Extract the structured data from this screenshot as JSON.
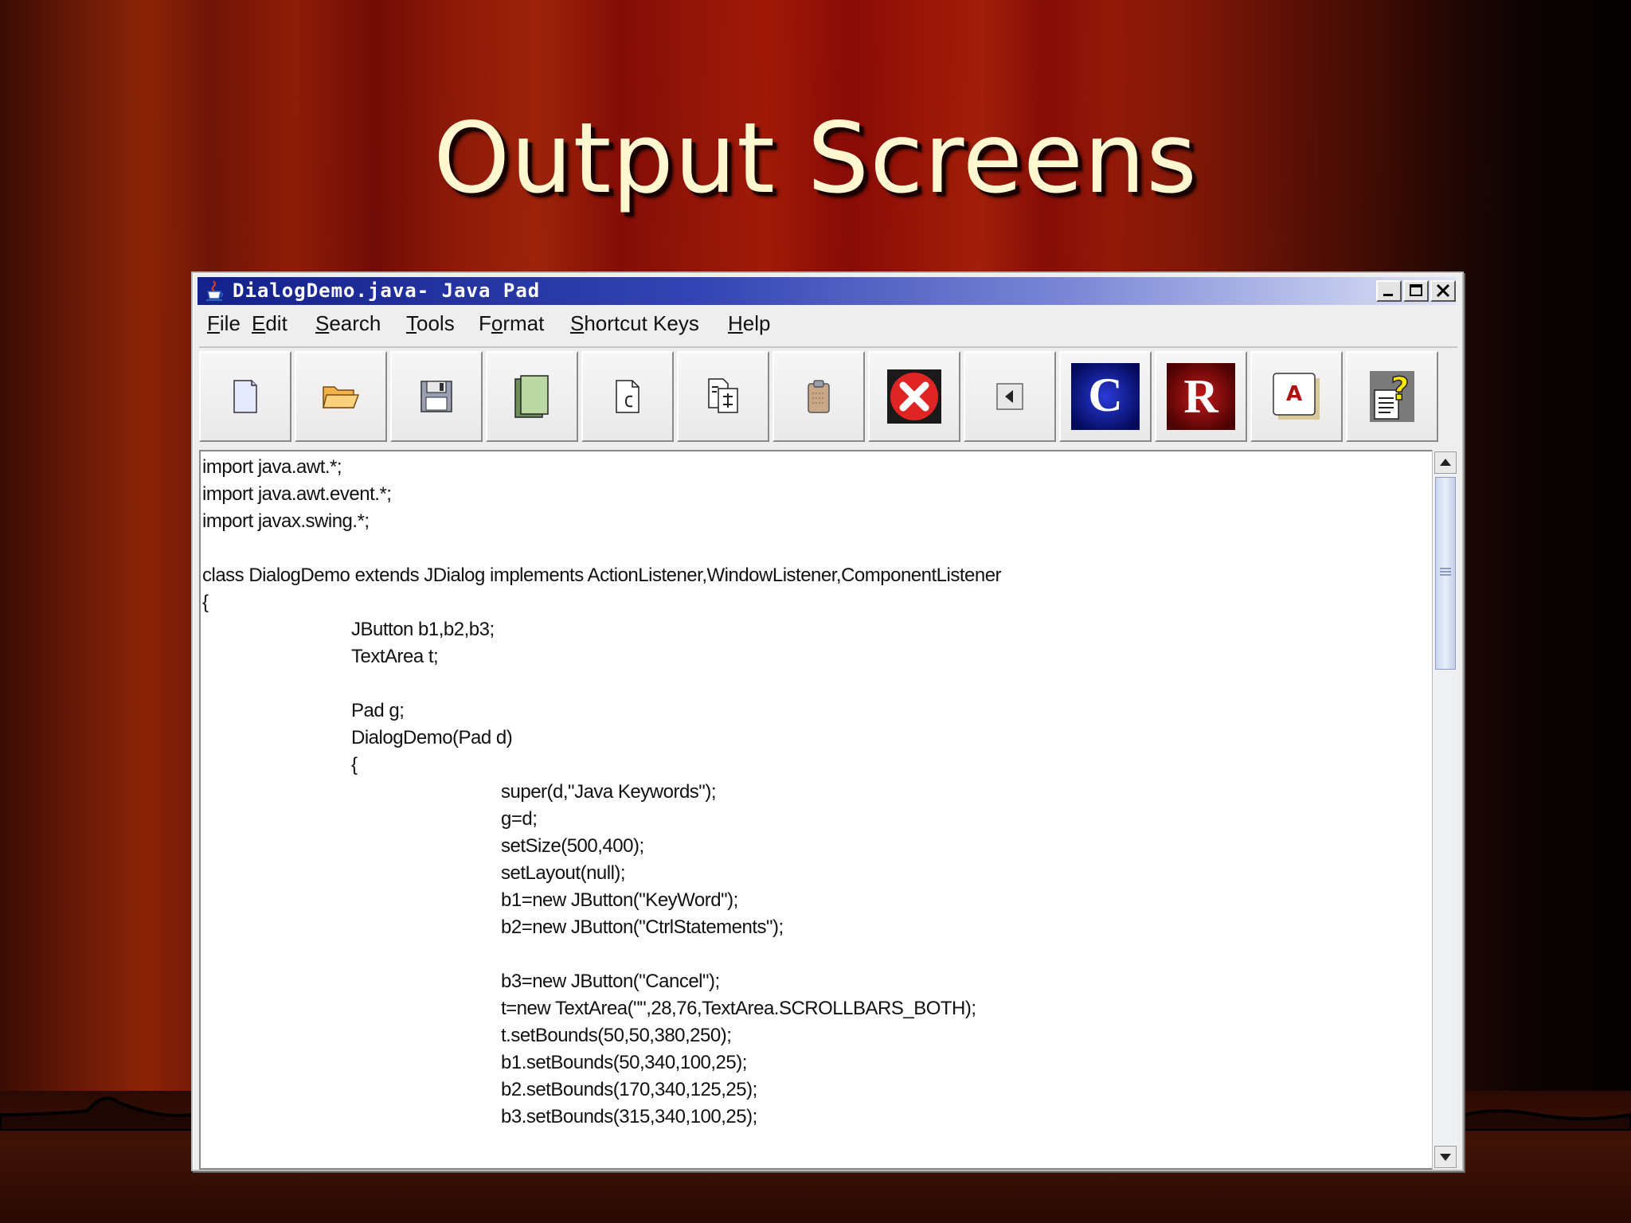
{
  "slide": {
    "title": "Output Screens"
  },
  "window": {
    "title": "DialogDemo.java- Java Pad",
    "controls": {
      "minimize": "minimize",
      "maximize": "maximize",
      "close": "close"
    }
  },
  "menubar": {
    "items": [
      {
        "mnemonic": "F",
        "rest": "ile"
      },
      {
        "mnemonic": "E",
        "rest": "dit"
      },
      {
        "mnemonic": "S",
        "rest": "earch"
      },
      {
        "mnemonic": "T",
        "rest": "ools"
      },
      {
        "pre": "F",
        "mnemonic": "o",
        "rest": "rmat"
      },
      {
        "mnemonic": "S",
        "rest": "hortcut Keys"
      },
      {
        "mnemonic": "H",
        "rest": "elp"
      }
    ]
  },
  "toolbar": {
    "buttons": [
      {
        "icon": "new-file-icon"
      },
      {
        "icon": "open-folder-icon"
      },
      {
        "icon": "save-disk-icon"
      },
      {
        "icon": "copy-pages-icon"
      },
      {
        "icon": "compile-page-icon"
      },
      {
        "icon": "run-page-icon"
      },
      {
        "icon": "clipboard-icon"
      },
      {
        "icon": "close-red-x-icon"
      },
      {
        "icon": "back-arrow-icon"
      },
      {
        "icon": "c-icon",
        "letter": "C"
      },
      {
        "icon": "r-icon",
        "letter": "R"
      },
      {
        "icon": "font-a-icon",
        "letter": "A"
      },
      {
        "icon": "help-icon",
        "letter": "?"
      }
    ]
  },
  "editor": {
    "lines": [
      "import java.awt.*;",
      "import java.awt.event.*;",
      "import javax.swing.*;",
      "",
      "class DialogDemo extends JDialog implements ActionListener,WindowListener,ComponentListener",
      "{",
      "JButton b1,b2,b3;",
      "TextArea t;",
      "",
      "Pad g;",
      "DialogDemo(Pad d)",
      "{",
      "super(d,\"Java Keywords\");",
      "g=d;",
      "setSize(500,400);",
      "setLayout(null);",
      "b1=new JButton(\"KeyWord\");",
      "b2=new JButton(\"CtrlStatements\");",
      "",
      "b3=new JButton(\"Cancel\");",
      "t=new TextArea(\"\",28,76,TextArea.SCROLLBARS_BOTH);",
      "t.setBounds(50,50,380,250);",
      "b1.setBounds(50,340,100,25);",
      "b2.setBounds(170,340,125,25);",
      "b3.setBounds(315,340,100,25);"
    ]
  }
}
